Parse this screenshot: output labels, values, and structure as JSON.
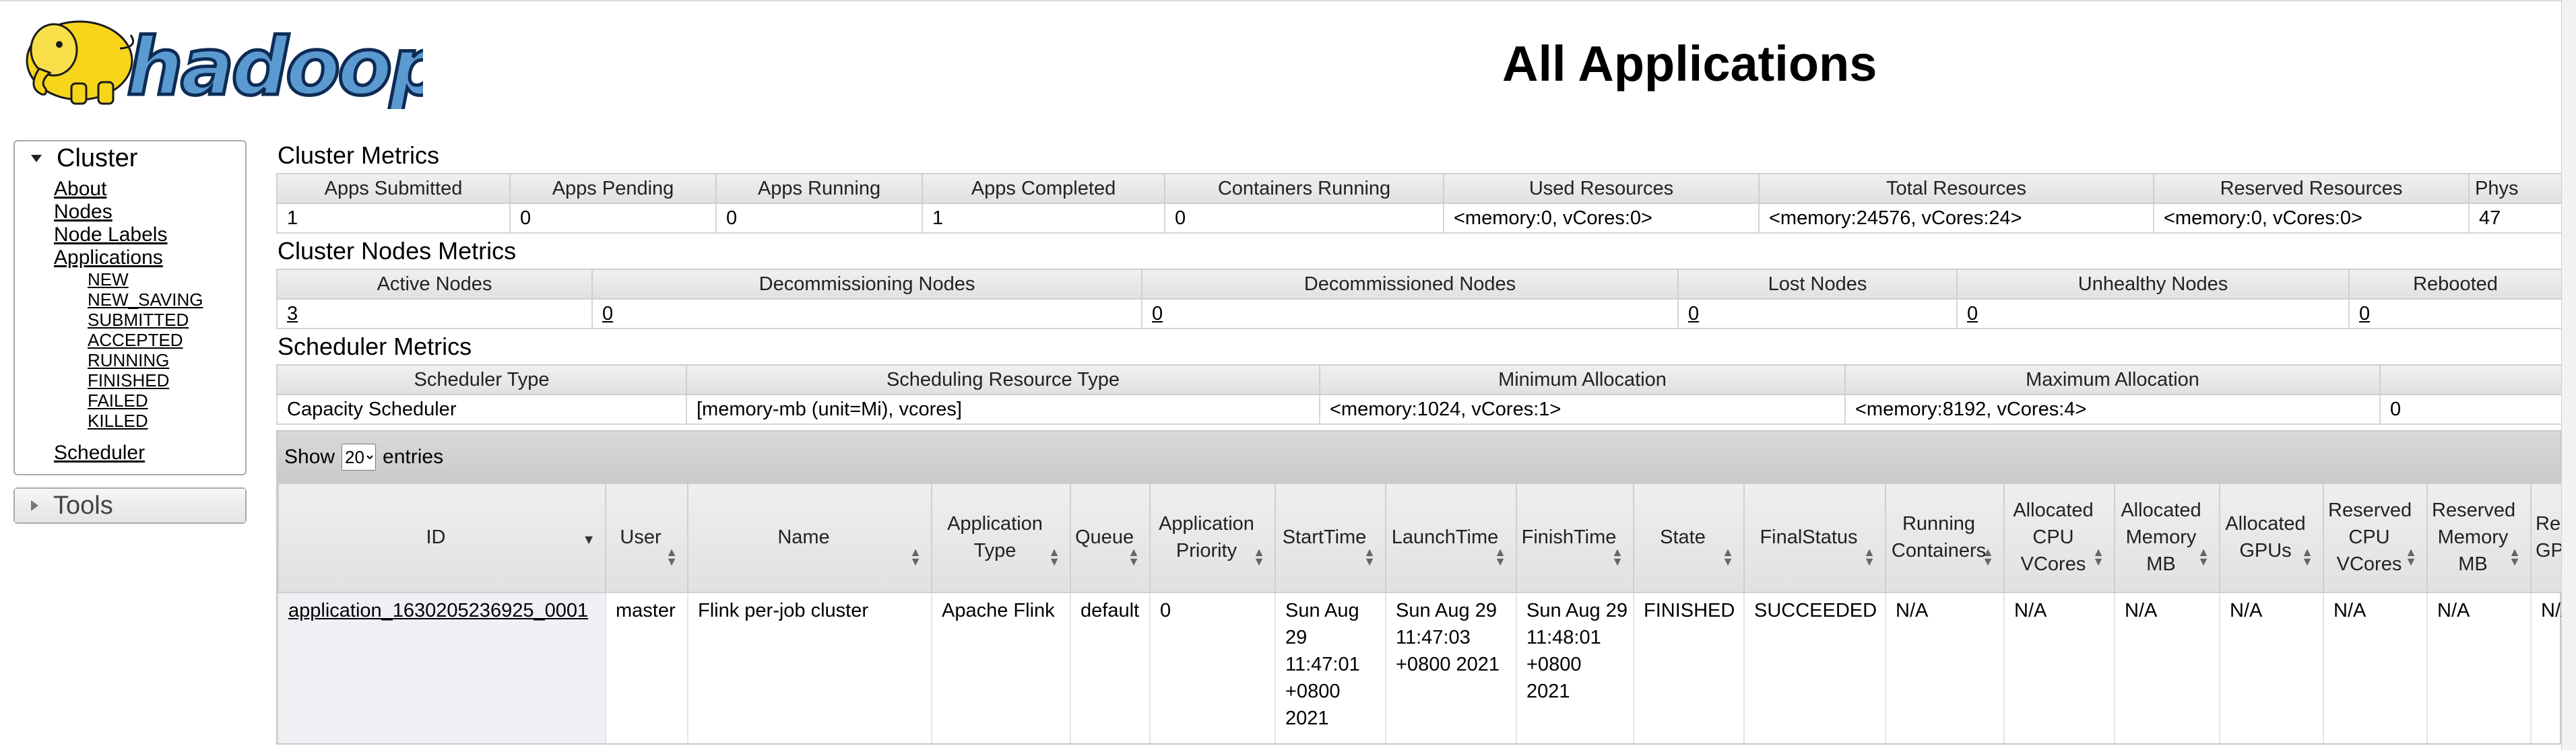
{
  "header": {
    "logo_text": "hadoop",
    "title": "All Applications"
  },
  "nav": {
    "cluster_label": "Cluster",
    "cluster_links": [
      "About",
      "Nodes",
      "Node Labels",
      "Applications"
    ],
    "app_states": [
      "NEW",
      "NEW_SAVING",
      "SUBMITTED",
      "ACCEPTED",
      "RUNNING",
      "FINISHED",
      "FAILED",
      "KILLED"
    ],
    "scheduler_label": "Scheduler",
    "tools_label": "Tools"
  },
  "cluster_metrics": {
    "title": "Cluster Metrics",
    "headers": [
      "Apps Submitted",
      "Apps Pending",
      "Apps Running",
      "Apps Completed",
      "Containers Running",
      "Used Resources",
      "Total Resources",
      "Reserved Resources",
      "Phys"
    ],
    "values": [
      "1",
      "0",
      "0",
      "1",
      "0",
      "<memory:0, vCores:0>",
      "<memory:24576, vCores:24>",
      "<memory:0, vCores:0>",
      "47"
    ]
  },
  "nodes_metrics": {
    "title": "Cluster Nodes Metrics",
    "headers": [
      "Active Nodes",
      "Decommissioning Nodes",
      "Decommissioned Nodes",
      "Lost Nodes",
      "Unhealthy Nodes",
      "Rebooted"
    ],
    "values": [
      "3",
      "0",
      "0",
      "0",
      "0",
      "0"
    ]
  },
  "scheduler_metrics": {
    "title": "Scheduler Metrics",
    "headers": [
      "Scheduler Type",
      "Scheduling Resource Type",
      "Minimum Allocation",
      "Maximum Allocation",
      ""
    ],
    "values": [
      "Capacity Scheduler",
      "[memory-mb (unit=Mi), vcores]",
      "<memory:1024, vCores:1>",
      "<memory:8192, vCores:4>",
      "0"
    ]
  },
  "apps_table": {
    "show_label": "Show",
    "page_size": "20",
    "page_size_options": [
      "20"
    ],
    "entries_label": "entries",
    "headers": [
      "ID",
      "User",
      "Name",
      "Application Type",
      "Queue",
      "Application Priority",
      "StartTime",
      "LaunchTime",
      "FinishTime",
      "State",
      "FinalStatus",
      "Running Containers",
      "Allocated CPU VCores",
      "Allocated Memory MB",
      "Allocated GPUs",
      "Reserved CPU VCores",
      "Reserved Memory MB",
      "Res GPU"
    ],
    "rows": [
      {
        "id": "application_1630205236925_0001",
        "user": "master",
        "name": "Flink per-job cluster",
        "type": "Apache Flink",
        "queue": "default",
        "priority": "0",
        "start": "Sun Aug 29 11:47:01 +0800 2021",
        "launch": "Sun Aug 29 11:47:03 +0800 2021",
        "finish": "Sun Aug 29 11:48:01 +0800 2021",
        "state": "FINISHED",
        "final_status": "SUCCEEDED",
        "running_containers": "N/A",
        "alloc_vcores": "N/A",
        "alloc_mem": "N/A",
        "alloc_gpus": "N/A",
        "res_vcores": "N/A",
        "res_mem": "N/A",
        "res_gpus": "N/A"
      }
    ]
  },
  "colors": {
    "header_bg": "#e4e4e4",
    "border": "#cfcfcf",
    "toolbar_bg": "#d0d0d0"
  }
}
